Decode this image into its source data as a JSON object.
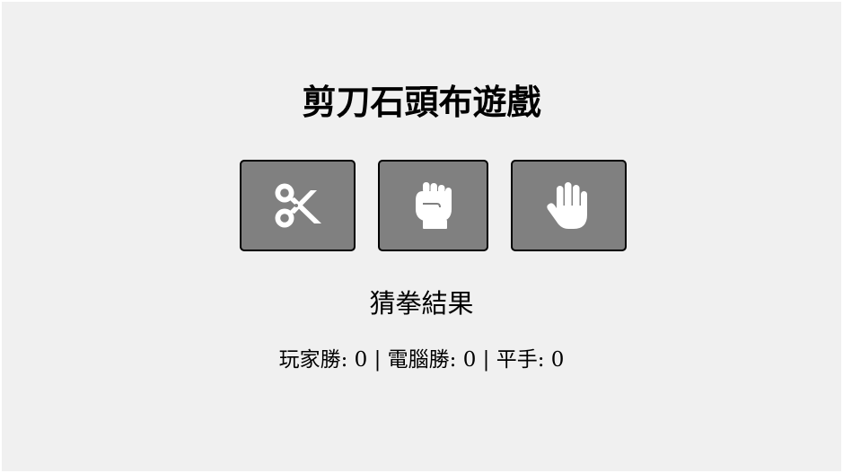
{
  "game": {
    "title": "剪刀石頭布遊戲",
    "choices": [
      {
        "id": "scissors",
        "icon": "scissors-icon"
      },
      {
        "id": "rock",
        "icon": "fist-icon"
      },
      {
        "id": "paper",
        "icon": "open-hand-icon"
      }
    ],
    "result_text": "猜拳結果",
    "score": {
      "player_label": "玩家勝:",
      "player_wins": 0,
      "computer_label": "電腦勝:",
      "computer_wins": 0,
      "draw_label": "平手:",
      "draws": 0,
      "separator": "|"
    }
  },
  "colors": {
    "background": "#f0f0f0",
    "button": "#808080",
    "icon": "#ffffff",
    "border": "#000000"
  }
}
